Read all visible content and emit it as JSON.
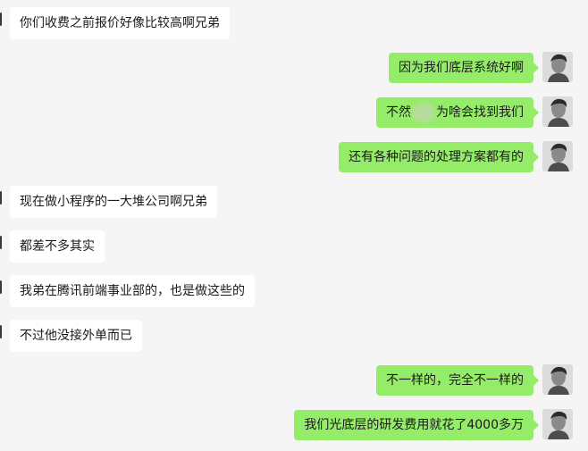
{
  "messages": [
    {
      "side": "left",
      "text": "你们收费之前报价好像比较高啊兄弟"
    },
    {
      "side": "right",
      "text": "因为我们底层系统好啊"
    },
    {
      "side": "right",
      "text_before": "不然",
      "text_after": "为啥会找到我们"
    },
    {
      "side": "right",
      "text": "还有各种问题的处理方案都有的"
    },
    {
      "side": "left",
      "text": "现在做小程序的一大堆公司啊兄弟"
    },
    {
      "side": "left",
      "text": "都差不多其实"
    },
    {
      "side": "left",
      "text": "我弟在腾讯前端事业部的，也是做这些的"
    },
    {
      "side": "left",
      "text": "不过他没接外单而已"
    },
    {
      "side": "right",
      "text": "不一样的，完全不一样的"
    },
    {
      "side": "right",
      "text": "我们光底层的研发费用就花了4000多万"
    }
  ],
  "colors": {
    "background": "#f5f5f5",
    "incoming_bubble": "#ffffff",
    "outgoing_bubble": "#95ec69"
  },
  "icons": {
    "avatar": "avatar-portrait-icon"
  }
}
